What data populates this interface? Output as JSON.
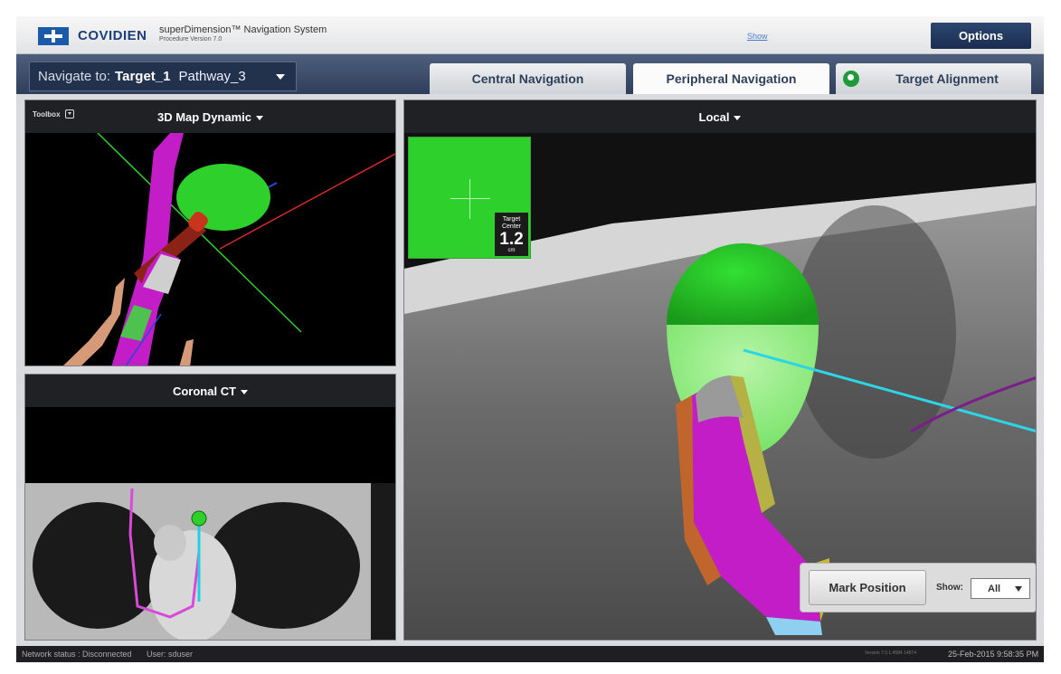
{
  "header": {
    "brand": "COVIDIEN",
    "title": "superDimension™ Navigation System",
    "subtitle": "Procedure Version 7.0",
    "show_link": "Show",
    "options_label": "Options"
  },
  "nav": {
    "prefix": "Navigate to:",
    "target": "Target_1",
    "pathway": "Pathway_3",
    "tabs": [
      {
        "label": "Central Navigation",
        "active": false
      },
      {
        "label": "Peripheral Navigation",
        "active": true
      },
      {
        "label": "Target Alignment",
        "active": false,
        "icon": "target-alignment-icon"
      }
    ]
  },
  "panels": {
    "map3d": {
      "title": "3D Map Dynamic",
      "toolbox": "Toolbox"
    },
    "coronal": {
      "title": "Coronal CT"
    },
    "local": {
      "title": "Local"
    }
  },
  "target_inset": {
    "line1": "Target",
    "line2": "Center",
    "value": "1.2",
    "unit": "cm"
  },
  "mark": {
    "button": "Mark Position",
    "show_label": "Show:",
    "show_value": "All"
  },
  "status": {
    "network": "Network status : Disconnected",
    "user": "User:  sduser",
    "version": "Version 7.0.1.4584 14874",
    "datetime": "25-Feb-2015 9:58:35 PM"
  },
  "colors": {
    "accent": "#2f3f5a",
    "target_green": "#2ed02b",
    "airway_magenta": "#c21dc6",
    "path_cyan": "#1fd0e0"
  }
}
